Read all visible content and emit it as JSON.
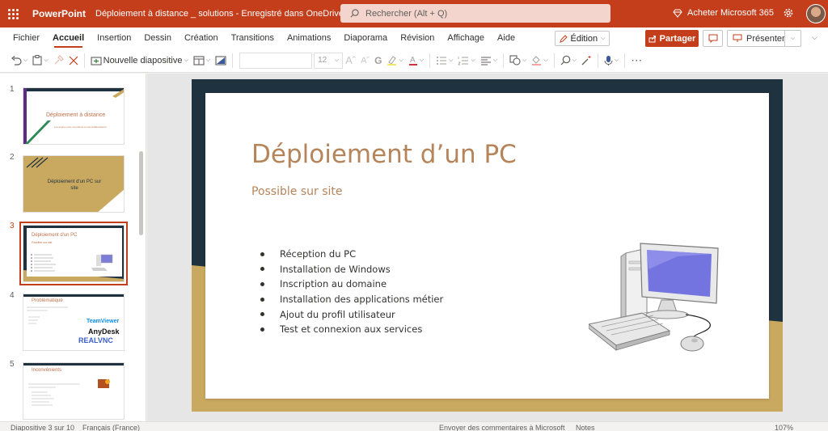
{
  "titlebar": {
    "app_name": "PowerPoint",
    "doc_title": "Déploiement à distance _ solutions  -  Enregistré dans OneDrive",
    "search_placeholder": "Rechercher (Alt + Q)",
    "buy_label": "Acheter Microsoft 365"
  },
  "tabs": [
    "Fichier",
    "Accueil",
    "Insertion",
    "Dessin",
    "Création",
    "Transitions",
    "Animations",
    "Diaporama",
    "Révision",
    "Affichage",
    "Aide"
  ],
  "active_tab": "Accueil",
  "actions": {
    "edition_label": "Édition",
    "share_label": "Partager",
    "present_label": "Présenter"
  },
  "toolbar": {
    "new_slide_label": "Nouvelle diapositive",
    "font_name": "",
    "font_size": "12"
  },
  "thumbnails": [
    {
      "number": "1",
      "title": "Déploiement à distance",
      "subtitle": "Les enjeux pour vos clients et vos collaborateurs"
    },
    {
      "number": "2",
      "title": "Déploiement d'un PC sur site"
    },
    {
      "number": "3",
      "title": "Déploiement d'un PC",
      "subtitle": "Possible sur site"
    },
    {
      "number": "4",
      "title": "Problématique",
      "logos": [
        "TeamViewer",
        "AnyDesk",
        "REALVNC"
      ]
    },
    {
      "number": "5",
      "title": "Inconvénients"
    }
  ],
  "slide": {
    "title": "Déploiement d’un PC",
    "subtitle": "Possible sur site",
    "bullets": [
      "Réception du PC",
      "Installation de Windows",
      "Inscription au domaine",
      "Installation des applications métier",
      "Ajout du profil utilisateur",
      "Test et connexion aux services"
    ]
  },
  "statusbar": {
    "slide_counter": "Diapositive 3 sur 10",
    "language": "Français (France)",
    "feedback": "Envoyer des commentaires à Microsoft",
    "notes": "Notes",
    "zoom": "107%"
  },
  "colors": {
    "accent": "#c43e1c",
    "slide_text": "#b5845a",
    "gold": "#c9a860",
    "dark_teal": "#1f3240"
  }
}
